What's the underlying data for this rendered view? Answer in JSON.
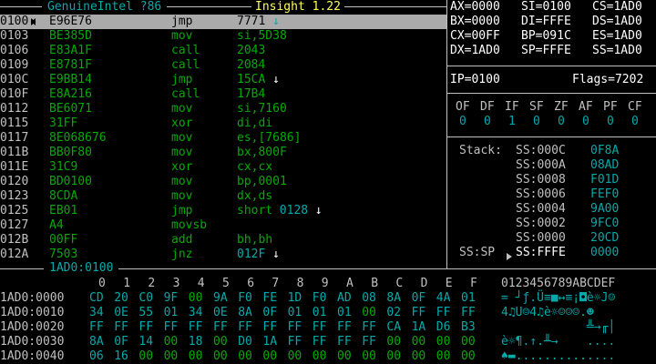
{
  "title_left": "GenuineIntel ?86",
  "title_center": "Insight 1.22",
  "disasm": [
    {
      "addr": "0100",
      "bytes": "E96E76",
      "mn": "jmp",
      "op": "7771",
      "op_color": "g",
      "arrow": "↓",
      "selected": true
    },
    {
      "addr": "0103",
      "bytes": "BE385D",
      "mn": "mov",
      "op": "si,5D38",
      "op_color": "g",
      "arrow": ""
    },
    {
      "addr": "0106",
      "bytes": "E83A1F",
      "mn": "call",
      "op": "2043",
      "op_color": "g",
      "arrow": ""
    },
    {
      "addr": "0109",
      "bytes": "E8781F",
      "mn": "call",
      "op": "2084",
      "op_color": "g",
      "arrow": ""
    },
    {
      "addr": "010C",
      "bytes": "E9BB14",
      "mn": "jmp",
      "op": "15CA",
      "op_color": "g",
      "arrow": "↓"
    },
    {
      "addr": "010F",
      "bytes": "E8A216",
      "mn": "call",
      "op": "17B4",
      "op_color": "g",
      "arrow": ""
    },
    {
      "addr": "0112",
      "bytes": "BE6071",
      "mn": "mov",
      "op": "si,7160",
      "op_color": "g",
      "arrow": ""
    },
    {
      "addr": "0115",
      "bytes": "31FF",
      "mn": "xor",
      "op": "di,di",
      "op_color": "g",
      "arrow": ""
    },
    {
      "addr": "0117",
      "bytes": "8E068676",
      "mn": "mov",
      "op": "es,[7686]",
      "op_color": "g",
      "arrow": ""
    },
    {
      "addr": "011B",
      "bytes": "BB0F80",
      "mn": "mov",
      "op": "bx,800F",
      "op_color": "g",
      "arrow": ""
    },
    {
      "addr": "011E",
      "bytes": "31C9",
      "mn": "xor",
      "op": "cx,cx",
      "op_color": "g",
      "arrow": ""
    },
    {
      "addr": "0120",
      "bytes": "BD0100",
      "mn": "mov",
      "op": "bp,0001",
      "op_color": "g",
      "arrow": ""
    },
    {
      "addr": "0123",
      "bytes": "8CDA",
      "mn": "mov",
      "op": "dx,ds",
      "op_color": "g",
      "arrow": ""
    },
    {
      "addr": "0125",
      "bytes": "EB01",
      "mn": "jmp",
      "op": "short",
      "op2": "0128",
      "op_color": "g",
      "arrow": "↓"
    },
    {
      "addr": "0127",
      "bytes": "A4",
      "mn": "movsb",
      "op": "",
      "op_color": "g",
      "arrow": ""
    },
    {
      "addr": "012B",
      "bytes": "00FF",
      "mn": "add",
      "op": "bh,bh",
      "op_color": "g",
      "arrow": ""
    },
    {
      "addr": "012A",
      "bytes": "7503",
      "mn": "jnz",
      "op": "012F",
      "op_color": "c",
      "arrow": "↓"
    }
  ],
  "registers": [
    [
      "AX=0000",
      "SI=0100",
      "CS=1AD0"
    ],
    [
      "BX=0000",
      "DI=FFFE",
      "DS=1AD0"
    ],
    [
      "CX=00FF",
      "BP=091C",
      "ES=1AD0"
    ],
    [
      "DX=1AD0",
      "SP=FFFE",
      "SS=1AD0"
    ]
  ],
  "ip": "IP=0100",
  "flags_value": "Flags=7202",
  "flag_names": [
    "OF",
    "DF",
    "IF",
    "SF",
    "ZF",
    "AF",
    "PF",
    "CF"
  ],
  "flag_values": [
    "0",
    "0",
    "1",
    "0",
    "0",
    "0",
    "0",
    "0"
  ],
  "stack_label": "Stack:",
  "stack": [
    {
      "addr": "SS:000C",
      "val": "0F8A"
    },
    {
      "addr": "SS:000A",
      "val": "08AD"
    },
    {
      "addr": "SS:0008",
      "val": "F01D"
    },
    {
      "addr": "SS:0006",
      "val": "FEF0"
    },
    {
      "addr": "SS:0004",
      "val": "9A00"
    },
    {
      "addr": "SS:0002",
      "val": "9FC0"
    },
    {
      "addr": "SS:0000",
      "val": "20CD"
    }
  ],
  "sssp_label": "SS:SP",
  "sssp_addr": "SS:FFFE",
  "sssp_val": "0000",
  "dump_title": "1AD0:0100",
  "dump_cols": [
    "0",
    "1",
    "2",
    "3",
    "4",
    "5",
    "6",
    "7",
    "8",
    "9",
    "A",
    "B",
    "C",
    "D",
    "E",
    "F"
  ],
  "dump_ascii_header": "0123456789ABCDEF",
  "dump": [
    {
      "addr": "1AD0:0000",
      "bytes": [
        "CD",
        "20",
        "C0",
        "9F",
        "00",
        "9A",
        "F0",
        "FE",
        "1D",
        "F0",
        "AD",
        "08",
        "8A",
        "0F",
        "4A",
        "01"
      ],
      "ascii": "= ┘ƒ.Ü≡■↔≡¡◘è☼J☺"
    },
    {
      "addr": "1AD0:0010",
      "bytes": [
        "34",
        "0E",
        "55",
        "01",
        "34",
        "0E",
        "8A",
        "0F",
        "01",
        "01",
        "01",
        "00",
        "02",
        "FF",
        "FF",
        "FF"
      ],
      "ascii": "4♫U☺4♫è☼☺☺☺.☻   "
    },
    {
      "addr": "1AD0:0020",
      "bytes": [
        "FF",
        "FF",
        "FF",
        "FF",
        "FF",
        "FF",
        "FF",
        "FF",
        "FF",
        "FF",
        "FF",
        "FF",
        "CA",
        "1A",
        "D6",
        "B3"
      ],
      "ascii": "            ╩→╓│"
    },
    {
      "addr": "1AD0:0030",
      "bytes": [
        "8A",
        "0F",
        "14",
        "00",
        "18",
        "00",
        "D0",
        "1A",
        "FF",
        "FF",
        "FF",
        "FF",
        "00",
        "00",
        "00",
        "00"
      ],
      "ascii": "è☼¶.↑.╨→    ...."
    },
    {
      "addr": "1AD0:0040",
      "bytes": [
        "06",
        "16",
        "00",
        "00",
        "00",
        "00",
        "00",
        "00",
        "00",
        "00",
        "00",
        "00",
        "00",
        "00",
        "00",
        "00"
      ],
      "ascii": "♠▬.............."
    }
  ]
}
